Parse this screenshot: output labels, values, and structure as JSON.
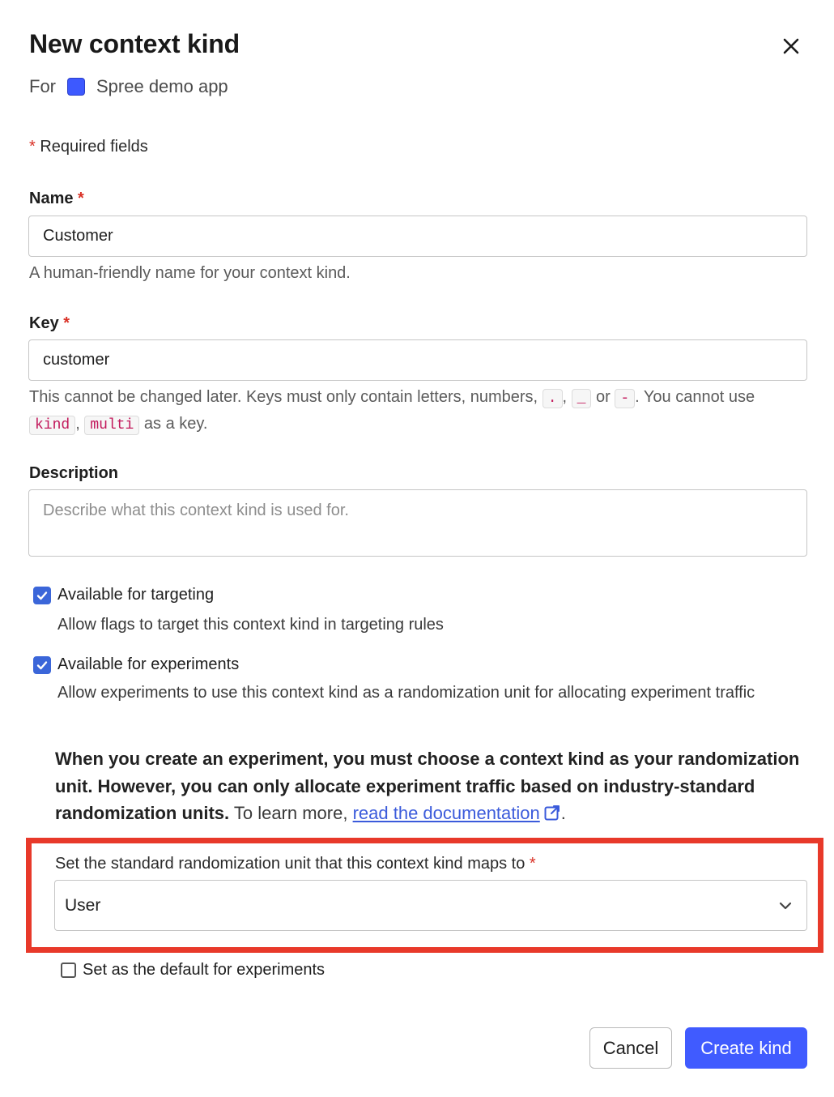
{
  "dialog": {
    "title": "New context kind",
    "for_label": "For",
    "project_name": "Spree demo app",
    "project_color": "#3d59ff",
    "required_star": "*",
    "required_note": "Required fields"
  },
  "name_field": {
    "label": "Name",
    "value": "Customer",
    "help": "A human-friendly name for your context kind."
  },
  "key_field": {
    "label": "Key",
    "value": "customer",
    "help_part1": "This cannot be changed later. Keys must only contain letters, numbers,",
    "tok_dot": ".",
    "sep1": ",",
    "tok_underscore": "_",
    "or_text": "or",
    "tok_dash": "-",
    "help_part2": ". You cannot use",
    "tok_kind": "kind",
    "sep2": ",",
    "tok_multi": "multi",
    "help_part3": "as a key."
  },
  "description_field": {
    "label": "Description",
    "placeholder": "Describe what this context kind is used for."
  },
  "targeting": {
    "checked": true,
    "label": "Available for targeting",
    "description": "Allow flags to target this context kind in targeting rules"
  },
  "experiments": {
    "checked": true,
    "label": "Available for experiments",
    "description": "Allow experiments to use this context kind as a randomization unit for allocating experiment traffic"
  },
  "experiment_note": {
    "bold_text": "When you create an experiment, you must choose a context kind as your randomization unit. However, you can only allocate experiment traffic based on industry-standard randomization units.",
    "normal_text": "To learn more,",
    "link_text": "read the documentation",
    "trailing": "."
  },
  "randomization": {
    "label": "Set the standard randomization unit that this context kind maps to",
    "selected": "User"
  },
  "default_option": {
    "checked": false,
    "label": "Set as the default for experiments"
  },
  "actions": {
    "cancel_label": "Cancel",
    "submit_label": "Create kind"
  },
  "colors": {
    "primary": "#405bff",
    "highlight": "#e8392a",
    "checkbox": "#3b66d9",
    "required": "#d93025"
  },
  "icons": {
    "close": "close-icon",
    "external_link": "external-link-icon",
    "chevron": "chevron-down-icon",
    "check": "check-icon"
  }
}
